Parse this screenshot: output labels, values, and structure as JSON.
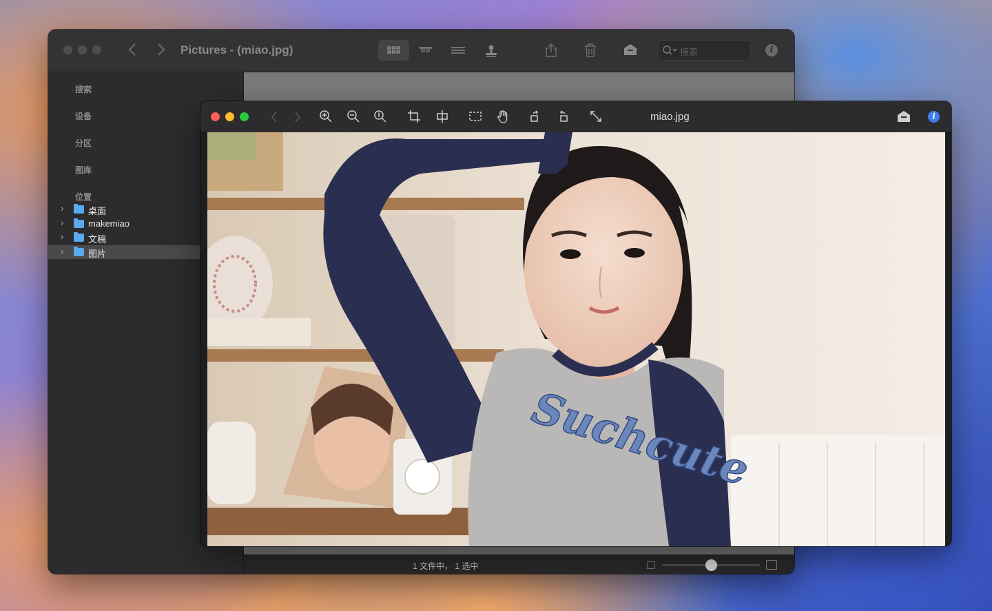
{
  "browser": {
    "title": "Pictures - (miao.jpg)",
    "search_placeholder": "搜索",
    "info_label": "i",
    "sidebar": {
      "sections": [
        "搜索",
        "设备",
        "分区",
        "图库",
        "位置"
      ],
      "items": [
        {
          "label": "桌面",
          "selected": false
        },
        {
          "label": "makemiao",
          "selected": false
        },
        {
          "label": "文稿",
          "selected": false
        },
        {
          "label": "图片",
          "selected": true
        }
      ]
    },
    "status": {
      "text": "1 文件中， 1 选中",
      "zoom_level": 0.5
    }
  },
  "viewer": {
    "title": "miao.jpg",
    "info_label": "i",
    "toolbar_icons": [
      "zoom-in-icon",
      "zoom-out-icon",
      "zoom-fit-icon",
      "crop-icon",
      "flip-icon",
      "select-icon",
      "hand-icon",
      "rotate-left-icon",
      "rotate-right-icon",
      "fullscreen-icon"
    ],
    "shirt_text": "Suchcute"
  },
  "colors": {
    "traffic_red": "#ff5f57",
    "traffic_yellow": "#febc2e",
    "traffic_green": "#28c840",
    "folder_blue": "#5aaaf0",
    "info_blue": "#3d7de8"
  }
}
